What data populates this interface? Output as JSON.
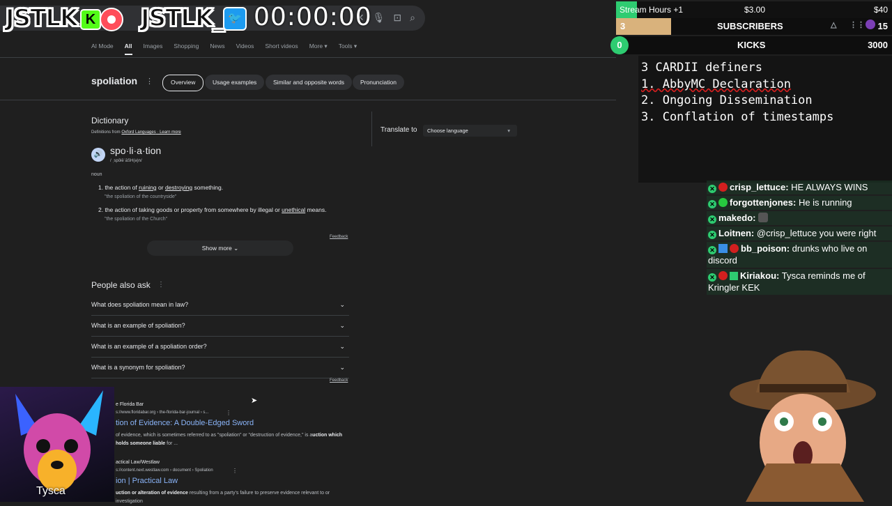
{
  "overlay": {
    "logo_left": "JSTLK",
    "logo_left_badge": "K",
    "logo_right": "JSTLK_",
    "timer": "00:00:00",
    "stream_hours": "Stream Hours +1",
    "stream_amount": "$3.00",
    "stream_goal": "$40",
    "stream_progress": 0.075,
    "subs_count": "3",
    "subs_label": "SUBSCRIBERS",
    "subs_goal": "15",
    "subs_progress": 0.2,
    "kicks_count": "0",
    "kicks_label": "KICKS",
    "kicks_goal": "3000",
    "notes": [
      "3 CARDII definers",
      "1. AbbyMC Declaration",
      "2. Ongoing Dissemination",
      "3. Conflation of timestamps"
    ],
    "webcam_name": "Tysca"
  },
  "chat": [
    {
      "user": "crisp_lettuce:",
      "text": " HE ALWAYS WINS"
    },
    {
      "user": "forgottenjones:",
      "text": " He is running"
    },
    {
      "user": "makedo:",
      "text": ""
    },
    {
      "user": "Loitnen:",
      "text": " @crisp_lettuce you were right"
    },
    {
      "user": "bb_poison:",
      "text": " drunks who live on discord"
    },
    {
      "user": "Kiriakou:",
      "text": " Tysca reminds me of Kringler KEK"
    }
  ],
  "google": {
    "tabs": [
      "AI Mode",
      "All",
      "Images",
      "Shopping",
      "News",
      "Videos",
      "Short videos",
      "More ▾",
      "Tools ▾"
    ],
    "term": "spoliation",
    "chips": [
      "Overview",
      "Usage examples",
      "Similar and opposite words",
      "Pronunciation"
    ],
    "dictionary": {
      "heading": "Dictionary",
      "source_prefix": "Definitions from ",
      "source": "Oxford Languages",
      "learn_more": " · Learn more",
      "word": "spo·li·a·tion",
      "phonetic": "/ ˌspōlēˈāSH(ə)n/",
      "pos": "noun",
      "def1_a": "1. the action of ",
      "def1_b": "ruining",
      "def1_c": " or ",
      "def1_d": "destroying",
      "def1_e": " something.",
      "ex1": "\"the spoliation of the countryside\"",
      "def2_a": "2. the action of taking goods or property from somewhere by illegal or ",
      "def2_b": "unethical",
      "def2_c": " means.",
      "ex2": "\"the spoliation of the Church\"",
      "feedback": "Feedback",
      "show_more": "Show more"
    },
    "translate_label": "Translate to",
    "translate_placeholder": "Choose language",
    "paa_heading": "People also ask",
    "paa": [
      "What does spoliation mean in law?",
      "What is an example of spoliation?",
      "What is an example of a spoliation order?",
      "What is a synonym for spoliation?"
    ],
    "paa_feedback": "Feedback",
    "results": [
      {
        "site": "e Florida Bar",
        "url": "s://www.floridabar.org › the-florida-bar-journal › s...",
        "title": "tion of Evidence: A Double-Edged Sword",
        "snippet_a": " of evidence, which is sometimes referred to as \"spoliation\" or \"destruction of evidence,\" is a",
        "snippet_b": "uction which holds someone liable",
        "snippet_c": " for ..."
      },
      {
        "site": "actical Law/Westlaw",
        "url": "s://content.next.westlaw.com › document › Spoliation",
        "title": "ion | Practical Law",
        "snippet_a": "uction or alteration of evidence",
        "snippet_b": " resulting from a party's failure to preserve evidence relevant to",
        "snippet_c": " or investigation"
      }
    ]
  }
}
